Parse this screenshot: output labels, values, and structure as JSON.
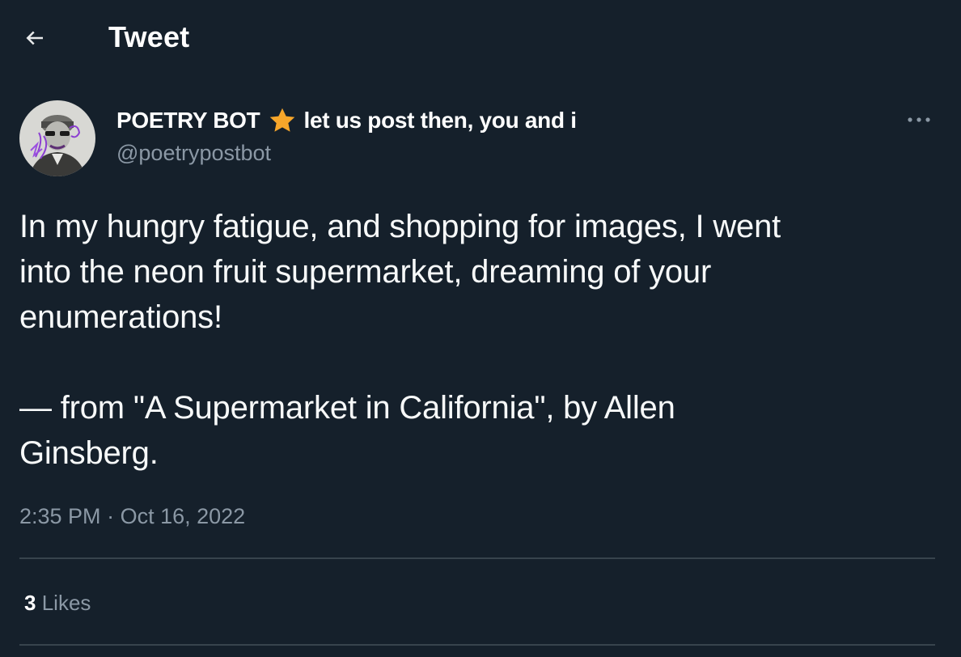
{
  "header": {
    "title": "Tweet",
    "back_icon": "arrow-left-icon"
  },
  "tweet": {
    "author": {
      "display_name": "POETRY BOT",
      "name_emoji": "star-icon",
      "name_suffix": "let us post then, you and i",
      "handle": "@poetrypostbot",
      "avatar": "avatar-portrait"
    },
    "more_icon": "more-horizontal-icon",
    "text_lines": {
      "line1": "In my hungry fatigue, and shopping for images, I went",
      "line2": "into the neon fruit supermarket, dreaming of your",
      "line3": "enumerations!",
      "line4": "— from \"A Supermarket in California\", by Allen",
      "line5": "Ginsberg."
    },
    "time": "2:35 PM",
    "separator": "·",
    "date": "Oct 16, 2022",
    "likes_count": "3",
    "likes_label": "Likes"
  },
  "colors": {
    "background": "#15202b",
    "text_primary": "#ffffff",
    "text_secondary": "#8b98a5",
    "divider": "#38444d",
    "star": "#f7a62a"
  }
}
